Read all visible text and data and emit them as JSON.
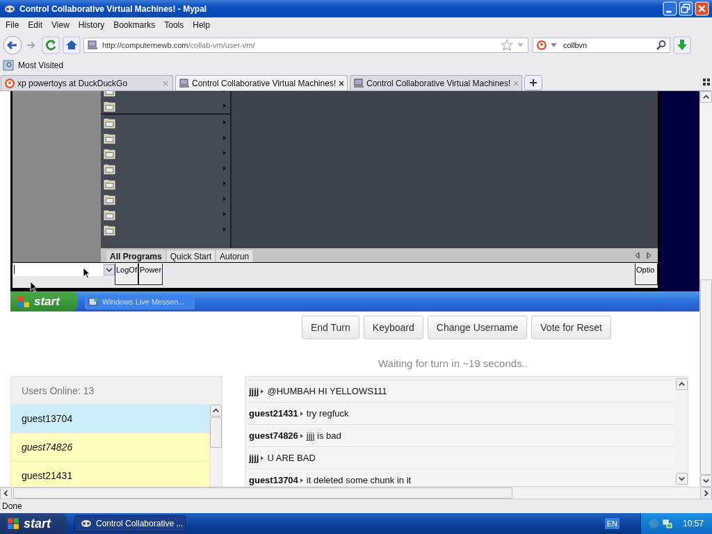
{
  "window": {
    "title": "Control Collaborative Virtual Machines! - Mypal"
  },
  "menu": [
    "File",
    "Edit",
    "View",
    "History",
    "Bookmarks",
    "Tools",
    "Help"
  ],
  "address": {
    "host": "http://computernewb.com",
    "path": "/collab-vm/user-vm/"
  },
  "search": {
    "value": "collbvn"
  },
  "bookmarks": [
    "Most Visited"
  ],
  "tabs": [
    {
      "label": "xp powertoys at DuckDuckGo",
      "kind": "duck",
      "selected": false
    },
    {
      "label": "Control Collaborative Virtual Machines!",
      "kind": "computer",
      "selected": true
    },
    {
      "label": "Control Collaborative Virtual Machines!",
      "kind": "computer",
      "selected": false
    }
  ],
  "vm": {
    "program_groups": [
      {
        "items": [
          {
            "kind": "folder"
          },
          {
            "kind": "folder"
          }
        ]
      },
      {
        "items": [
          {
            "kind": "folder"
          },
          {
            "kind": "folder"
          },
          {
            "kind": "folder"
          },
          {
            "kind": "folder"
          },
          {
            "kind": "folder"
          },
          {
            "kind": "folder"
          },
          {
            "kind": "folder"
          },
          {
            "kind": "folder"
          }
        ]
      }
    ],
    "menu_tabs": [
      {
        "label": "All Programs",
        "selected": true
      },
      {
        "label": "Quick Start",
        "selected": false
      },
      {
        "label": "Autorun",
        "selected": false
      }
    ],
    "bottom_buttons": [
      "LogOf",
      "Power"
    ],
    "option_button": "Optio",
    "taskbar": {
      "start": "start",
      "tasks": [
        "Windows Live Messen..."
      ]
    }
  },
  "controls": [
    "End Turn",
    "Keyboard",
    "Change Username",
    "Vote for Reset"
  ],
  "turn_status": "Waiting for turn in ~19 seconds..",
  "users": {
    "header": "Users Online: 13",
    "list": [
      {
        "name": "guest13704",
        "color": "#cdeef8",
        "italic": false
      },
      {
        "name": "guest74826",
        "color": "#fffcbc",
        "italic": true
      },
      {
        "name": "guest21431",
        "color": "#fffcbc",
        "italic": false
      }
    ]
  },
  "chat": [
    {
      "user": "jjjj",
      "text": "@HUMBAH HI YELLOWS111"
    },
    {
      "user": "guest21431",
      "text": "try regfuck"
    },
    {
      "user": "guest74826",
      "text": "jjjj is bad"
    },
    {
      "user": "jjjj",
      "text": "U ARE BAD"
    },
    {
      "user": "guest13704",
      "text": "it deleted some chunk in it"
    }
  ],
  "status_bar": "Done",
  "taskbar": {
    "start": "start",
    "tasks": [
      "Control Collaborative ..."
    ],
    "language": "EN",
    "clock": "10:57"
  }
}
